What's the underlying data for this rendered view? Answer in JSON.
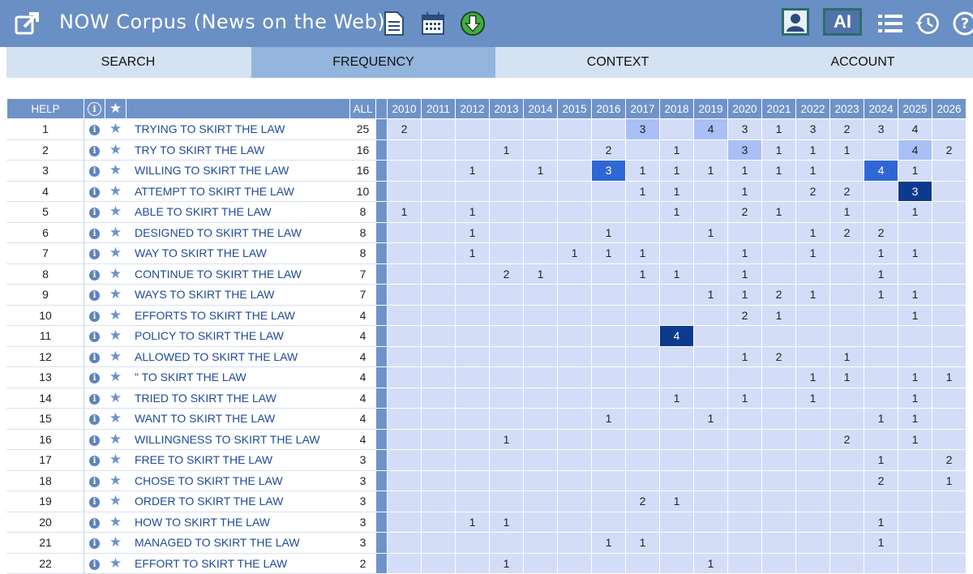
{
  "header": {
    "title": "NOW Corpus (News on the Web)",
    "ai_label": "AI"
  },
  "tabs": [
    {
      "label": "SEARCH",
      "active": false
    },
    {
      "label": "FREQUENCY",
      "active": true
    },
    {
      "label": "CONTEXT",
      "active": false
    },
    {
      "label": "ACCOUNT",
      "active": false
    }
  ],
  "table": {
    "help_label": "HELP",
    "all_label": "ALL",
    "years": [
      "2010",
      "2011",
      "2012",
      "2013",
      "2014",
      "2015",
      "2016",
      "2017",
      "2018",
      "2019",
      "2020",
      "2021",
      "2022",
      "2023",
      "2024",
      "2025",
      "2026"
    ],
    "rows": [
      {
        "n": "1",
        "phrase": "TRYING TO SKIRT THE LAW",
        "all": "25",
        "v": [
          "2",
          "",
          "",
          "",
          "",
          "",
          "",
          "3",
          "",
          "4",
          "3",
          "1",
          "3",
          "2",
          "3",
          "4",
          ""
        ]
      },
      {
        "n": "2",
        "phrase": "TRY TO SKIRT THE LAW",
        "all": "16",
        "v": [
          "",
          "",
          "",
          "1",
          "",
          "",
          "2",
          "",
          "1",
          "",
          "3",
          "1",
          "1",
          "1",
          "",
          "4",
          "2"
        ]
      },
      {
        "n": "3",
        "phrase": "WILLING TO SKIRT THE LAW",
        "all": "16",
        "v": [
          "",
          "",
          "1",
          "",
          "1",
          "",
          "3",
          "1",
          "1",
          "1",
          "1",
          "1",
          "1",
          "",
          "4",
          "1",
          ""
        ]
      },
      {
        "n": "4",
        "phrase": "ATTEMPT TO SKIRT THE LAW",
        "all": "10",
        "v": [
          "",
          "",
          "",
          "",
          "",
          "",
          "",
          "1",
          "1",
          "",
          "1",
          "",
          "2",
          "2",
          "",
          "3",
          ""
        ]
      },
      {
        "n": "5",
        "phrase": "ABLE TO SKIRT THE LAW",
        "all": "8",
        "v": [
          "1",
          "",
          "1",
          "",
          "",
          "",
          "",
          "",
          "1",
          "",
          "2",
          "1",
          "",
          "1",
          "",
          "1",
          ""
        ]
      },
      {
        "n": "6",
        "phrase": "DESIGNED TO SKIRT THE LAW",
        "all": "8",
        "v": [
          "",
          "",
          "1",
          "",
          "",
          "",
          "1",
          "",
          "",
          "1",
          "",
          "",
          "1",
          "2",
          "2",
          "",
          ""
        ]
      },
      {
        "n": "7",
        "phrase": "WAY TO SKIRT THE LAW",
        "all": "8",
        "v": [
          "",
          "",
          "1",
          "",
          "",
          "1",
          "1",
          "1",
          "",
          "",
          "1",
          "",
          "1",
          "",
          "1",
          "1",
          ""
        ]
      },
      {
        "n": "8",
        "phrase": "CONTINUE TO SKIRT THE LAW",
        "all": "7",
        "v": [
          "",
          "",
          "",
          "2",
          "1",
          "",
          "",
          "1",
          "1",
          "",
          "1",
          "",
          "",
          "",
          "1",
          "",
          ""
        ]
      },
      {
        "n": "9",
        "phrase": "WAYS TO SKIRT THE LAW",
        "all": "7",
        "v": [
          "",
          "",
          "",
          "",
          "",
          "",
          "",
          "",
          "",
          "1",
          "1",
          "2",
          "1",
          "",
          "1",
          "1",
          ""
        ]
      },
      {
        "n": "10",
        "phrase": "EFFORTS TO SKIRT THE LAW",
        "all": "4",
        "v": [
          "",
          "",
          "",
          "",
          "",
          "",
          "",
          "",
          "",
          "",
          "2",
          "1",
          "",
          "",
          "",
          "1",
          ""
        ]
      },
      {
        "n": "11",
        "phrase": "POLICY TO SKIRT THE LAW",
        "all": "4",
        "v": [
          "",
          "",
          "",
          "",
          "",
          "",
          "",
          "",
          "4",
          "",
          "",
          "",
          "",
          "",
          "",
          "",
          ""
        ]
      },
      {
        "n": "12",
        "phrase": "ALLOWED TO SKIRT THE LAW",
        "all": "4",
        "v": [
          "",
          "",
          "",
          "",
          "",
          "",
          "",
          "",
          "",
          "",
          "1",
          "2",
          "",
          "1",
          "",
          "",
          ""
        ]
      },
      {
        "n": "13",
        "phrase": "\" TO SKIRT THE LAW",
        "all": "4",
        "v": [
          "",
          "",
          "",
          "",
          "",
          "",
          "",
          "",
          "",
          "",
          "",
          "",
          "1",
          "1",
          "",
          "1",
          "1"
        ]
      },
      {
        "n": "14",
        "phrase": "TRIED TO SKIRT THE LAW",
        "all": "4",
        "v": [
          "",
          "",
          "",
          "",
          "",
          "",
          "",
          "",
          "1",
          "",
          "1",
          "",
          "1",
          "",
          "",
          "1",
          ""
        ]
      },
      {
        "n": "15",
        "phrase": "WANT TO SKIRT THE LAW",
        "all": "4",
        "v": [
          "",
          "",
          "",
          "",
          "",
          "",
          "1",
          "",
          "",
          "1",
          "",
          "",
          "",
          "",
          "1",
          "1",
          ""
        ]
      },
      {
        "n": "16",
        "phrase": "WILLINGNESS TO SKIRT THE LAW",
        "all": "4",
        "v": [
          "",
          "",
          "",
          "1",
          "",
          "",
          "",
          "",
          "",
          "",
          "",
          "",
          "",
          "2",
          "",
          "1",
          ""
        ]
      },
      {
        "n": "17",
        "phrase": "FREE TO SKIRT THE LAW",
        "all": "3",
        "v": [
          "",
          "",
          "",
          "",
          "",
          "",
          "",
          "",
          "",
          "",
          "",
          "",
          "",
          "",
          "1",
          "",
          "2"
        ]
      },
      {
        "n": "18",
        "phrase": "CHOSE TO SKIRT THE LAW",
        "all": "3",
        "v": [
          "",
          "",
          "",
          "",
          "",
          "",
          "",
          "",
          "",
          "",
          "",
          "",
          "",
          "",
          "2",
          "",
          "1"
        ]
      },
      {
        "n": "19",
        "phrase": "ORDER TO SKIRT THE LAW",
        "all": "3",
        "v": [
          "",
          "",
          "",
          "",
          "",
          "",
          "",
          "2",
          "1",
          "",
          "",
          "",
          "",
          "",
          "",
          "",
          ""
        ]
      },
      {
        "n": "20",
        "phrase": "HOW TO SKIRT THE LAW",
        "all": "3",
        "v": [
          "",
          "",
          "1",
          "1",
          "",
          "",
          "",
          "",
          "",
          "",
          "",
          "",
          "",
          "",
          "1",
          "",
          ""
        ]
      },
      {
        "n": "21",
        "phrase": "MANAGED TO SKIRT THE LAW",
        "all": "3",
        "v": [
          "",
          "",
          "",
          "",
          "",
          "",
          "1",
          "1",
          "",
          "",
          "",
          "",
          "",
          "",
          "1",
          "",
          ""
        ]
      },
      {
        "n": "22",
        "phrase": "EFFORT TO SKIRT THE LAW",
        "all": "2",
        "v": [
          "",
          "",
          "",
          "1",
          "",
          "",
          "",
          "",
          "",
          "1",
          "",
          "",
          "",
          "",
          "",
          "",
          ""
        ]
      }
    ],
    "highlights": [
      {
        "row": 0,
        "col": 7,
        "color": "#a9bff5"
      },
      {
        "row": 0,
        "col": 9,
        "color": "#a9bff5"
      },
      {
        "row": 1,
        "col": 10,
        "color": "#a9bff5"
      },
      {
        "row": 1,
        "col": 15,
        "color": "#a9bff5"
      },
      {
        "row": 2,
        "col": 6,
        "color": "#2f67d6"
      },
      {
        "row": 2,
        "col": 14,
        "color": "#2f67d6"
      },
      {
        "row": 3,
        "col": 15,
        "color": "#0c3a8c"
      },
      {
        "row": 10,
        "col": 8,
        "color": "#0c3a8c"
      }
    ]
  }
}
